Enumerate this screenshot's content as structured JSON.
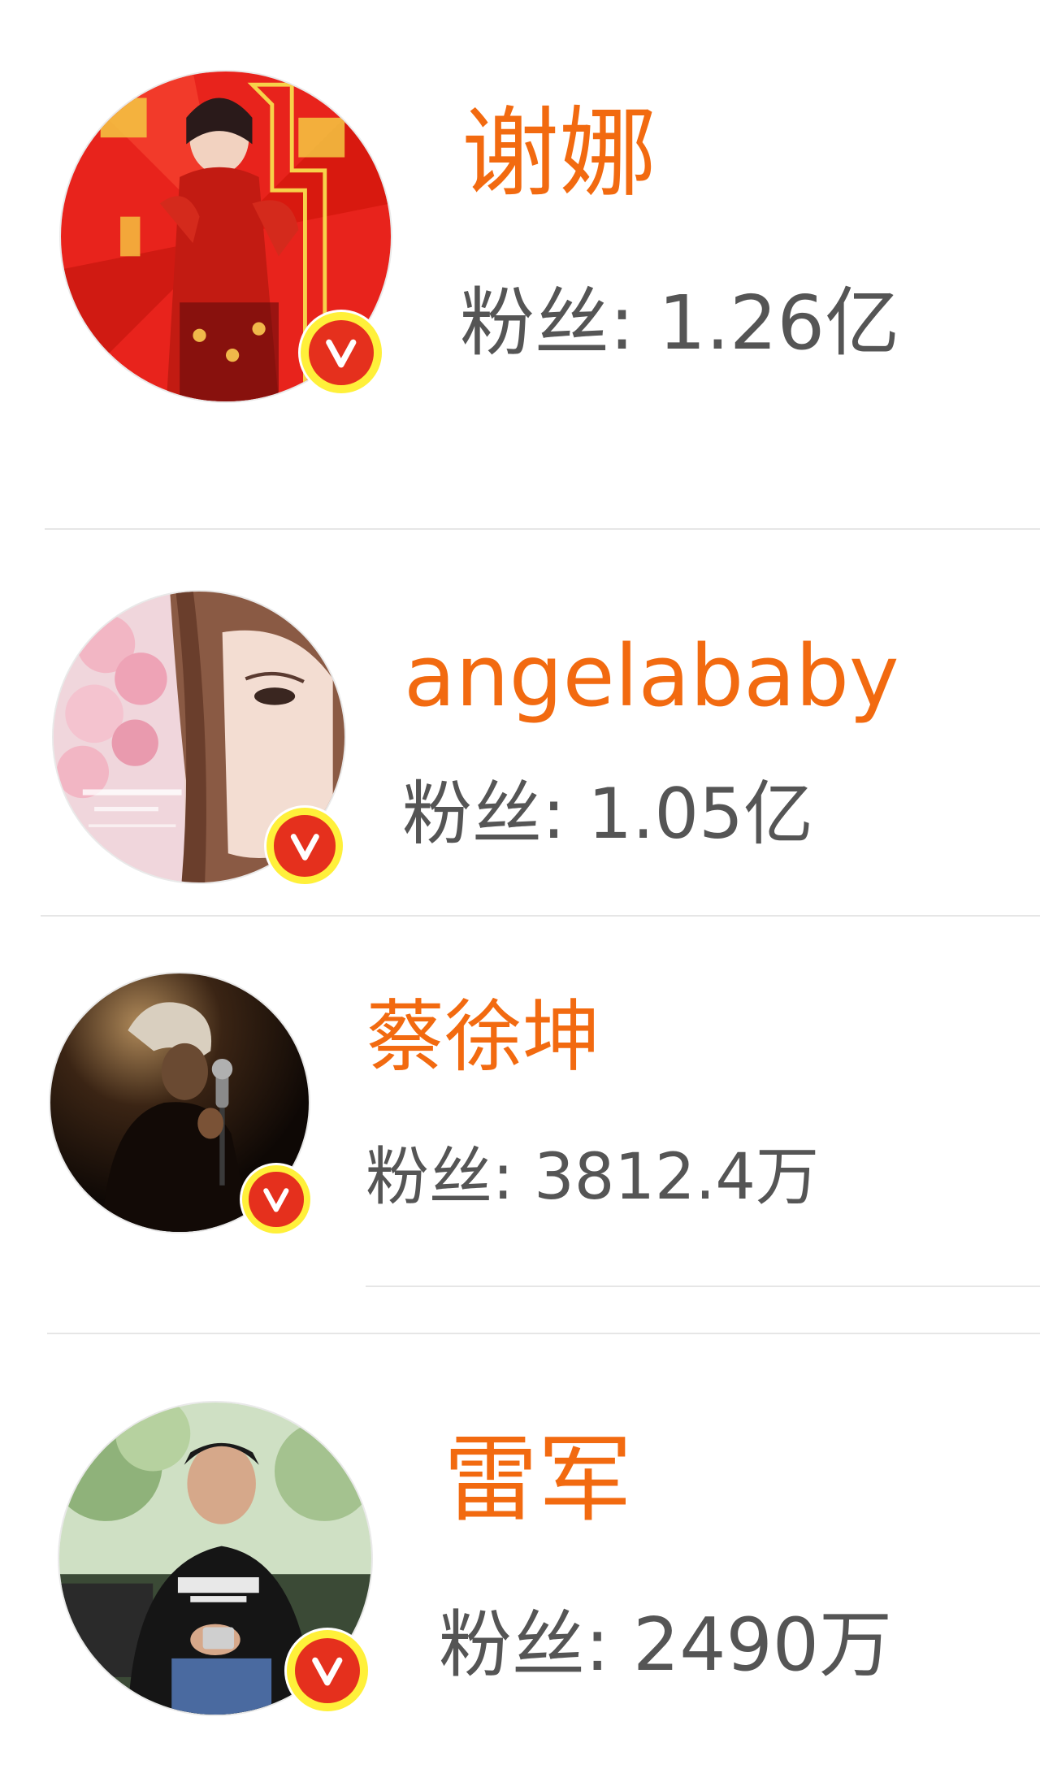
{
  "users": [
    {
      "name": "谢娜",
      "fans_label": "粉丝:",
      "fans_value": "1.26亿",
      "verified": true
    },
    {
      "name": "angelababy",
      "fans_label": "粉丝:",
      "fans_value": "1.05亿",
      "verified": true
    },
    {
      "name": "蔡徐坤",
      "fans_label": "粉丝:",
      "fans_value": "3812.4万",
      "verified": true
    },
    {
      "name": "雷军",
      "fans_label": "粉丝:",
      "fans_value": "2490万",
      "verified": true
    }
  ],
  "icons": {
    "verified_badge": "verified-v-badge-icon",
    "verified_badge_colors": {
      "ring": "#fff03a",
      "fill": "#e5301d",
      "glyph": "#ffffff"
    }
  },
  "colors": {
    "name": "#f26a10",
    "fans_text": "#555555",
    "divider": "#e6e6e6",
    "background": "#ffffff"
  }
}
